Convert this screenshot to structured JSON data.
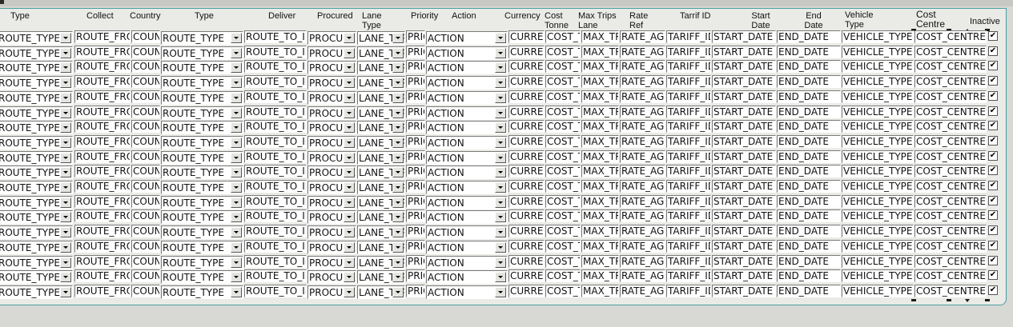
{
  "columns": {
    "type1": "Type",
    "collect": "Collect",
    "country": "Country",
    "type2": "Type",
    "deliver": "Deliver",
    "procured": "Procured",
    "lane_type": "Lane Type",
    "priority": "Priority",
    "action": "Action",
    "currency": "Currency",
    "cost_tonne": "Cost Tonne",
    "max_trips_lane": "Max Trips Lane",
    "rate_ref": "Rate Ref",
    "tarrif_id": "Tarrif ID",
    "start_date": "Start Date",
    "end_date": "End Date",
    "vehicle_type": "Vehicle Type",
    "cost_centre": "Cost Centre",
    "inactive": "Inactive"
  },
  "row_values": {
    "route_type_from": "ROUTE_TYPE",
    "route_from": "ROUTE_FROM",
    "country": "COUNTRY",
    "route_type_to": "ROUTE_TYPE",
    "route_to": "ROUTE_TO_ID",
    "procured": "PROCURED",
    "lane_type": "LANE_TYPE",
    "priority": "PRIORITY",
    "action": "ACTION",
    "currency": "CURRENCY",
    "cost_tonne": "COST_TONNE",
    "max_trips": "MAX_TRIPS",
    "rate_agreement": "RATE_AGREEMENT",
    "tariff_id": "TARIFF_ID",
    "start_date": "START_DATE",
    "end_date": "END_DATE",
    "vehicle_type": "VEHICLE_TYPE",
    "cost_centre": "COST_CENTRE",
    "inactive_mark": "✔"
  },
  "row_count": 18,
  "colors": {
    "panel_border": "#4aa0a0",
    "panel_bg": "#eaeae6",
    "window_bg": "#d8d8d4"
  }
}
